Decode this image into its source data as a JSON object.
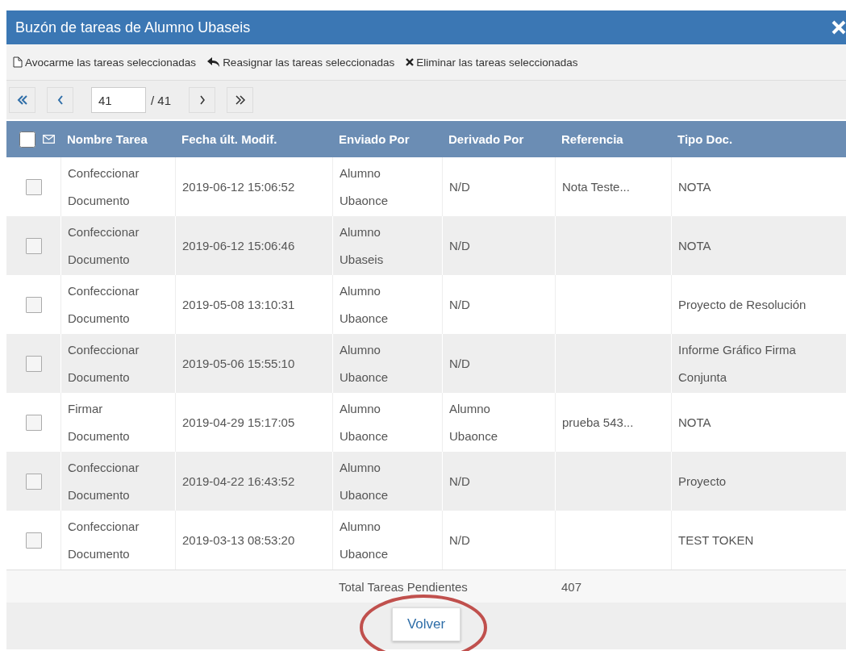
{
  "window": {
    "title": "Buzón de tareas de Alumno Ubaseis"
  },
  "toolbar": [
    {
      "kind": "take",
      "label": "Avocarme las tareas seleccionadas"
    },
    {
      "kind": "reassign",
      "label": "Reasignar las tareas seleccionadas"
    },
    {
      "kind": "delete",
      "label": "Eliminar las tareas seleccionadas"
    }
  ],
  "pager": {
    "page": "41",
    "total": "/ 41"
  },
  "table": {
    "select_all": {
      "checked": false
    },
    "columns": [
      "Nombre Tarea",
      "Fecha últ. Modif.",
      "Enviado Por",
      "Derivado Por",
      "Referencia",
      "Tipo Doc."
    ],
    "rows": [
      {
        "checked": false,
        "cells": [
          "Confeccionar Documento",
          "2019-06-12 15:06:52",
          "Alumno Ubaonce",
          "N/D",
          "Nota Teste...",
          "NOTA"
        ]
      },
      {
        "checked": false,
        "cells": [
          "Confeccionar Documento",
          "2019-06-12 15:06:46",
          "Alumno Ubaseis",
          "N/D",
          "",
          "NOTA"
        ]
      },
      {
        "checked": false,
        "cells": [
          "Confeccionar Documento",
          "2019-05-08 13:10:31",
          "Alumno Ubaonce",
          "N/D",
          "",
          "Proyecto de Resolución"
        ]
      },
      {
        "checked": false,
        "cells": [
          "Confeccionar Documento",
          "2019-05-06 15:55:10",
          "Alumno Ubaonce",
          "N/D",
          "",
          "Informe Gráfico Firma Conjunta"
        ]
      },
      {
        "checked": false,
        "cells": [
          "Firmar Documento",
          "2019-04-29 15:17:05",
          "Alumno Ubaonce",
          "Alumno Ubaonce",
          "prueba 543...",
          "NOTA"
        ]
      },
      {
        "checked": false,
        "cells": [
          "Confeccionar Documento",
          "2019-04-22 16:43:52",
          "Alumno Ubaonce",
          "N/D",
          "",
          "Proyecto"
        ]
      },
      {
        "checked": false,
        "cells": [
          "Confeccionar Documento",
          "2019-03-13 08:53:20",
          "Alumno Ubaonce",
          "N/D",
          "",
          "TEST TOKEN"
        ]
      }
    ],
    "total": {
      "label": "Total Tareas Pendientes",
      "value": "407"
    }
  },
  "footer": {
    "button": "Volver",
    "highlighted": true
  }
}
